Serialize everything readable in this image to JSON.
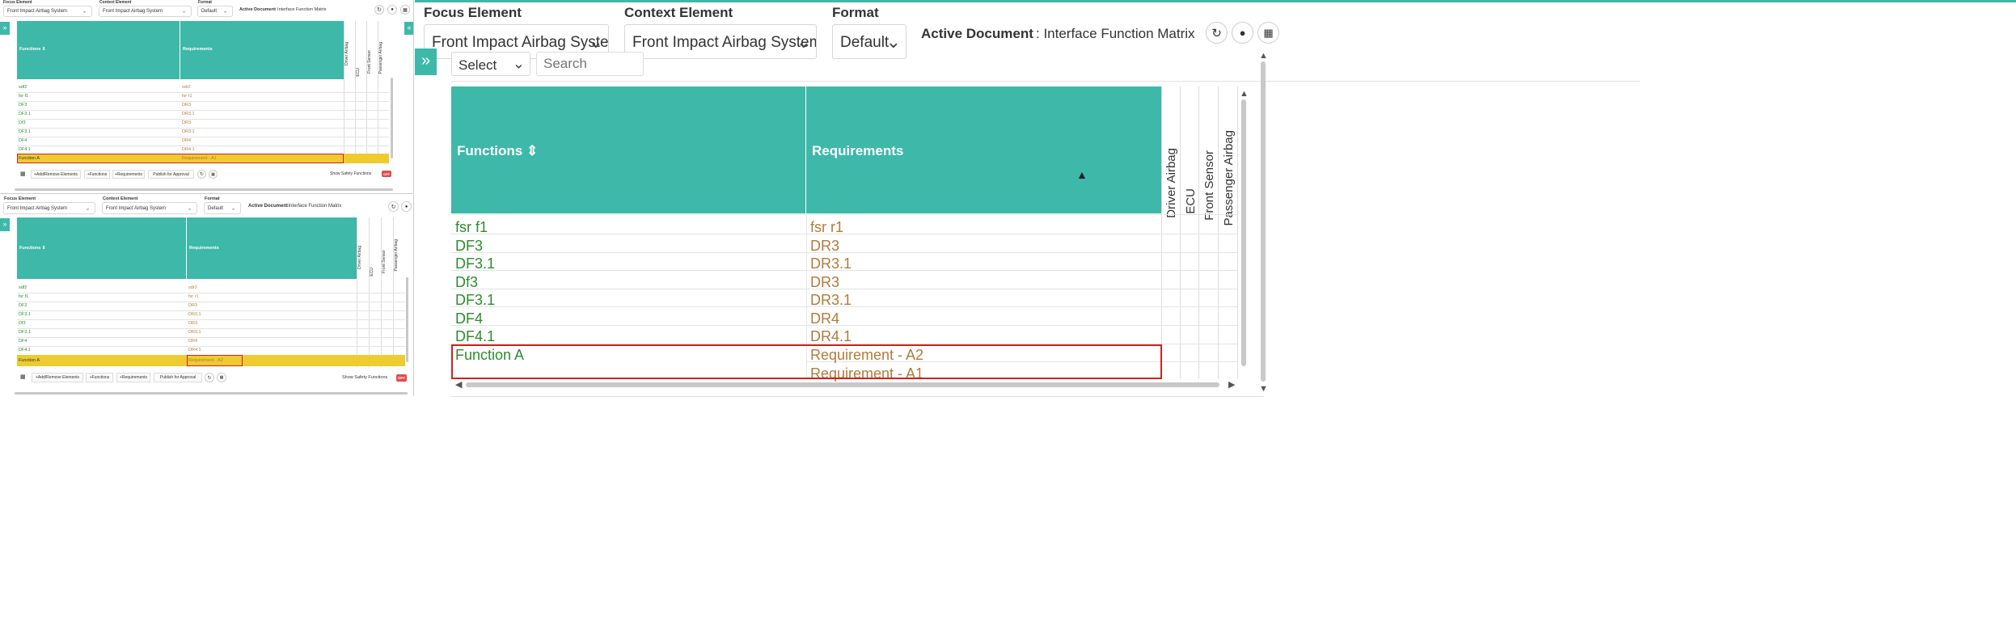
{
  "header": {
    "focus_label": "Focus Element",
    "focus_value": "Front Impact Airbag System",
    "context_label": "Context Element",
    "context_value": "Front Impact Airbag System",
    "format_label": "Format",
    "format_value": "Default",
    "active_doc_label": "Active Document",
    "active_doc_value": ": Interface Function Matrix"
  },
  "toolbar": {
    "select_value": "Select",
    "search_placeholder": "Search",
    "add_remove": "+Add/Remove Elements",
    "functions": "+Functions",
    "requirements": "+Requirements",
    "publish": "Publish for Approval",
    "safety_label": "Show Safety Functions",
    "safety_toggle": "OFF"
  },
  "table": {
    "col_functions": "Functions",
    "col_requirements": "Requirements",
    "sort_icon": "⇕",
    "matrix_columns": [
      "Driver Airbag",
      "ECU",
      "Front Sensor",
      "Passenger Airbag"
    ],
    "partial_rows": [
      {
        "fn": "sdf2",
        "rq": "sdr2"
      },
      {
        "fn": "fsr f1",
        "rq": "fsr r1"
      },
      {
        "fn": "DF3",
        "rq": "DR3"
      },
      {
        "fn": "DF3.1",
        "rq": "DR3.1"
      },
      {
        "fn": "Df3",
        "rq": "DR3"
      },
      {
        "fn": "DF3.1",
        "rq": "DR3.1"
      },
      {
        "fn": "DF4",
        "rq": "DR4"
      },
      {
        "fn": "DF4.1",
        "rq": "DR4.1"
      }
    ],
    "main_rows": [
      {
        "fn": "fsr f1",
        "rq": "fsr r1"
      },
      {
        "fn": "DF3",
        "rq": "DR3"
      },
      {
        "fn": "DF3.1",
        "rq": "DR3.1"
      },
      {
        "fn": "Df3",
        "rq": "DR3"
      },
      {
        "fn": "DF3.1",
        "rq": "DR3.1"
      },
      {
        "fn": "DF4",
        "rq": "DR4"
      },
      {
        "fn": "DF4.1",
        "rq": "DR4.1"
      }
    ],
    "function_a": "Function A",
    "req_a1": "Requirement - A1",
    "req_a2": "Requirement - A2"
  },
  "icons": {
    "expand": "»",
    "collapse": "«",
    "chevron": "⌄",
    "refresh": "↻",
    "drop": "●",
    "grid": "▦"
  },
  "colors": {
    "header": "#3db8a9",
    "function_text": "#2e8b2e",
    "requirement_text": "#b27a3b",
    "highlight": "#eecb30",
    "selection_border": "#d42020"
  }
}
